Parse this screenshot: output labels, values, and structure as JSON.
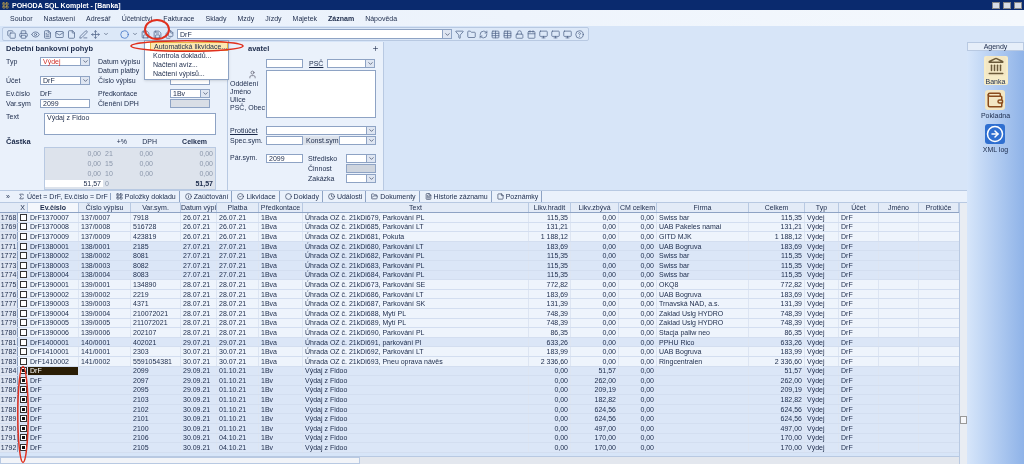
{
  "window": {
    "title": "POHODA SQL Komplet - [Banka]"
  },
  "menu": [
    {
      "label": "Soubor",
      "active": false
    },
    {
      "label": "Nastavení",
      "active": false
    },
    {
      "label": "Adresář",
      "active": false
    },
    {
      "label": "Účetnictví",
      "active": false
    },
    {
      "label": "Fakturace",
      "active": false
    },
    {
      "label": "Sklady",
      "active": false
    },
    {
      "label": "Mzdy",
      "active": false
    },
    {
      "label": "Jízdy",
      "active": false
    },
    {
      "label": "Majetek",
      "active": false
    },
    {
      "label": "Záznam",
      "active": true
    },
    {
      "label": "Nápověda",
      "active": false
    }
  ],
  "toolbar": {
    "combo_value": "DrF"
  },
  "dropdown": [
    {
      "label": "Automatická likvidace...",
      "selected": true
    },
    {
      "label": "Kontrola dokladů...",
      "selected": false
    },
    {
      "label": "Načtení avíz...",
      "selected": false
    },
    {
      "label": "Načtení výpisů...",
      "selected": false
    }
  ],
  "form": {
    "title": "Debetní bankovní pohyb",
    "typ_label": "Typ",
    "typ": "Výdej",
    "datum_vypisu_label": "Datum výpisu",
    "datum_platby_label": "Datum platby",
    "ucet_label": "Účet",
    "ucet": "DrF",
    "cislo_vypisu_label": "Číslo výpisu",
    "ev_cislo_label": "Ev.číslo",
    "ev_cislo": "DrF",
    "predkontace_label": "Předkontace",
    "predkontace": "1Bv",
    "var_sym_label": "Var.sym",
    "var_sym": "2099",
    "cleneni_label": "Členění DPH",
    "text_label": "Text",
    "text": "Výdaj z Fidoo",
    "castka_label": "Částka",
    "vat_headers": [
      "+%",
      "DPH",
      "Celkem"
    ],
    "vat_rows": [
      {
        "base": "0,00",
        "rate": "21",
        "vat": "0,00",
        "total": "0,00",
        "editable": false
      },
      {
        "base": "0,00",
        "rate": "15",
        "vat": "0,00",
        "total": "0,00",
        "editable": false
      },
      {
        "base": "0,00",
        "rate": "10",
        "vat": "0,00",
        "total": "0,00",
        "editable": false
      },
      {
        "base": "51,57",
        "rate": "0",
        "total": "51,57",
        "editable": true
      }
    ]
  },
  "partner": {
    "title": "avatel",
    "psc_label": "PSČ",
    "oddeleni_label": "Oddělení",
    "jmeno_label": "Jméno",
    "ulice_label": "Ulice",
    "psc_obec_label": "PSČ, Obec",
    "protiucet_label": "Protiúčet",
    "spec_sym_label": "Spec.sym.",
    "konst_sym_label": "Konst.sym.",
    "par_sym_label": "Pár.sym.",
    "par_sym": "2099",
    "stredisko_label": "Středisko",
    "cinnost_label": "Činnost",
    "zakazka_label": "Zakázka"
  },
  "agendy": {
    "title": "Agendy",
    "items": [
      {
        "label": "Banka",
        "selected": true,
        "kind": "bank"
      },
      {
        "label": "Pokladna",
        "selected": false,
        "kind": "wallet"
      },
      {
        "label": "XML log",
        "selected": false,
        "kind": "log"
      }
    ]
  },
  "tabs": {
    "more": "»",
    "filter": "Účet = DrF, Ev.číslo = DrF",
    "items": [
      {
        "label": "Položky dokladu",
        "selected": false
      },
      {
        "label": "Zaúčtování",
        "selected": false
      },
      {
        "label": "Likvidace",
        "selected": false
      },
      {
        "label": "Doklady",
        "selected": false
      },
      {
        "label": "Události",
        "selected": false
      },
      {
        "label": "Dokumenty",
        "selected": false
      },
      {
        "label": "Historie záznamu",
        "selected": false
      },
      {
        "label": "Poznámky",
        "selected": false
      }
    ]
  },
  "table": {
    "checkbox_header": "X",
    "columns": [
      {
        "label": "Ev.číslo",
        "sorted": true
      },
      {
        "label": "Číslo výpisu",
        "sorted": false
      },
      {
        "label": "Var.sym.",
        "sorted": false
      },
      {
        "label": "Datum výpi",
        "sorted": false
      },
      {
        "label": "Platba",
        "sorted": false
      },
      {
        "label": "Předkontace",
        "sorted": false
      },
      {
        "label": "Text",
        "sorted": false
      },
      {
        "label": "Likv.hradit",
        "sorted": false
      },
      {
        "label": "Likv.zbývá",
        "sorted": false
      },
      {
        "label": "CM celkem",
        "sorted": false
      },
      {
        "label": "Firma",
        "sorted": false
      },
      {
        "label": "Celkem",
        "sorted": false
      },
      {
        "label": "Typ",
        "sorted": false
      },
      {
        "label": "Účet",
        "sorted": false
      },
      {
        "label": "Jméno",
        "sorted": false
      },
      {
        "label": "Protiúče",
        "sorted": false
      }
    ],
    "rows": [
      {
        "number": "1768",
        "checked": false,
        "selected": false,
        "shaded": false,
        "cells": [
          "DrF1370007",
          "137/0007",
          "7918",
          "26.07.21",
          "26.07.21",
          "1Bva",
          "Úhrada OZ č. 21kDi679, Parkování PL",
          "115,35",
          "0,00",
          "0,00",
          "Swiss bar",
          "115,35",
          "Výdej",
          "DrF"
        ]
      },
      {
        "number": "1769",
        "checked": false,
        "selected": false,
        "shaded": false,
        "cells": [
          "DrF1370008",
          "137/0008",
          "516728",
          "26.07.21",
          "26.07.21",
          "1Bva",
          "Úhrada OZ č. 21kDi685, Parkování LT",
          "131,21",
          "0,00",
          "0,00",
          "UAB Pakeles namai",
          "131,21",
          "Výdej",
          "DrF"
        ]
      },
      {
        "number": "1770",
        "checked": false,
        "selected": false,
        "shaded": false,
        "cells": [
          "DrF1370009",
          "137/0009",
          "423819",
          "26.07.21",
          "26.07.21",
          "1Bva",
          "Úhrada OZ č. 21kDi681, Pokuta",
          "1 188,12",
          "0,00",
          "0,00",
          "GITD MJK",
          "1 188,12",
          "Výdej",
          "DrF"
        ]
      },
      {
        "number": "1771",
        "checked": false,
        "selected": false,
        "shaded": true,
        "cells": [
          "DrF1380001",
          "138/0001",
          "2185",
          "27.07.21",
          "27.07.21",
          "1Bva",
          "Úhrada OZ č. 21kDi680, Parkování LT",
          "183,69",
          "0,00",
          "0,00",
          "UAB Bogruva",
          "183,69",
          "Výdej",
          "DrF"
        ]
      },
      {
        "number": "1772",
        "checked": false,
        "selected": false,
        "shaded": true,
        "cells": [
          "DrF1380002",
          "138/0002",
          "8081",
          "27.07.21",
          "27.07.21",
          "1Bva",
          "Úhrada OZ č. 21kDi682, Parkování PL",
          "115,35",
          "0,00",
          "0,00",
          "Swiss bar",
          "115,35",
          "Výdej",
          "DrF"
        ]
      },
      {
        "number": "1773",
        "checked": false,
        "selected": false,
        "shaded": true,
        "cells": [
          "DrF1380003",
          "138/0003",
          "8082",
          "27.07.21",
          "27.07.21",
          "1Bva",
          "Úhrada OZ č. 21kDi683, Parkování PL",
          "115,35",
          "0,00",
          "0,00",
          "Swiss bar",
          "115,35",
          "Výdej",
          "DrF"
        ]
      },
      {
        "number": "1774",
        "checked": false,
        "selected": false,
        "shaded": true,
        "cells": [
          "DrF1380004",
          "138/0004",
          "8083",
          "27.07.21",
          "27.07.21",
          "1Bva",
          "Úhrada OZ č. 21kDi684, Parkování PL",
          "115,35",
          "0,00",
          "0,00",
          "Swiss bar",
          "115,35",
          "Výdej",
          "DrF"
        ]
      },
      {
        "number": "1775",
        "checked": false,
        "selected": false,
        "shaded": false,
        "cells": [
          "DrF1390001",
          "139/0001",
          "134890",
          "28.07.21",
          "28.07.21",
          "1Bva",
          "Úhrada OZ č. 21kDi673, Parkování SE",
          "772,82",
          "0,00",
          "0,00",
          "OKQ8",
          "772,82",
          "Výdej",
          "DrF"
        ]
      },
      {
        "number": "1776",
        "checked": false,
        "selected": false,
        "shaded": false,
        "cells": [
          "DrF1390002",
          "139/0002",
          "2219",
          "28.07.21",
          "28.07.21",
          "1Bva",
          "Úhrada OZ č. 21kDi686, Parkování LT",
          "183,69",
          "0,00",
          "0,00",
          "UAB Bogruva",
          "183,69",
          "Výdej",
          "DrF"
        ]
      },
      {
        "number": "1777",
        "checked": false,
        "selected": false,
        "shaded": false,
        "cells": [
          "DrF1390003",
          "139/0003",
          "4371",
          "28.07.21",
          "28.07.21",
          "1Bva",
          "Úhrada OZ č. 21kDi687, Parkování SK",
          "131,39",
          "0,00",
          "0,00",
          "Trnavská NAD, a.s.",
          "131,39",
          "Výdej",
          "DrF"
        ]
      },
      {
        "number": "1778",
        "checked": false,
        "selected": false,
        "shaded": false,
        "cells": [
          "DrF1390004",
          "139/0004",
          "210072021",
          "28.07.21",
          "28.07.21",
          "1Bva",
          "Úhrada OZ č. 21kDi688, Mytí PL",
          "748,39",
          "0,00",
          "0,00",
          "Zaklad Uslg HYDRO",
          "748,39",
          "Výdej",
          "DrF"
        ]
      },
      {
        "number": "1779",
        "checked": false,
        "selected": false,
        "shaded": false,
        "cells": [
          "DrF1390005",
          "139/0005",
          "211072021",
          "28.07.21",
          "28.07.21",
          "1Bva",
          "Úhrada OZ č. 21kDi689, Mytí PL",
          "748,39",
          "0,00",
          "0,00",
          "Zaklad Uslg HYDRO",
          "748,39",
          "Výdej",
          "DrF"
        ]
      },
      {
        "number": "1780",
        "checked": false,
        "selected": false,
        "shaded": false,
        "cells": [
          "DrF1390006",
          "139/0006",
          "202107",
          "28.07.21",
          "28.07.21",
          "1Bva",
          "Úhrada OZ č. 21kDi690, Parkování PL",
          "86,35",
          "0,00",
          "0,00",
          "Stacja paliw neo",
          "86,35",
          "Výdej",
          "DrF"
        ]
      },
      {
        "number": "1781",
        "checked": false,
        "selected": false,
        "shaded": true,
        "cells": [
          "DrF1400001",
          "140/0001",
          "402021",
          "29.07.21",
          "29.07.21",
          "1Bva",
          "Úhrada OZ č. 21kDi691, parkování Pl",
          "633,26",
          "0,00",
          "0,00",
          "PPHU Rico",
          "633,26",
          "Výdej",
          "DrF"
        ]
      },
      {
        "number": "1782",
        "checked": false,
        "selected": false,
        "shaded": false,
        "cells": [
          "DrF1410001",
          "141/0001",
          "2303",
          "30.07.21",
          "30.07.21",
          "1Bva",
          "Úhrada OZ č. 21kDi692, Parkování LT",
          "183,99",
          "0,00",
          "0,00",
          "UAB Bogruva",
          "183,99",
          "Výdej",
          "DrF"
        ]
      },
      {
        "number": "1783",
        "checked": false,
        "selected": false,
        "shaded": false,
        "cells": [
          "DrF1410002",
          "141/0002",
          "5591054381",
          "30.07.21",
          "30.07.21",
          "1Bva",
          "Úhrada OZ č. 21kDi693, Pneu oprava návěs",
          "2 336,60",
          "0,00",
          "0,00",
          "Ringcentralen",
          "2 336,60",
          "Výdej",
          "DrF"
        ]
      },
      {
        "number": "1784",
        "checked": true,
        "selected": true,
        "shaded": true,
        "cells": [
          "DrF",
          null,
          "2099",
          "29.09.21",
          "01.10.21",
          "1Bv",
          "Výdaj z Fidoo",
          "0,00",
          "51,57",
          "0,00",
          null,
          "51,57",
          "Výdej",
          "DrF"
        ]
      },
      {
        "number": "1785",
        "checked": true,
        "selected": false,
        "shaded": true,
        "cells": [
          "DrF",
          null,
          "2097",
          "29.09.21",
          "01.10.21",
          "1Bv",
          "Výdaj z Fidoo",
          "0,00",
          "262,00",
          "0,00",
          null,
          "262,00",
          "Výdej",
          "DrF"
        ]
      },
      {
        "number": "1786",
        "checked": true,
        "selected": false,
        "shaded": true,
        "cells": [
          "DrF",
          null,
          "2095",
          "29.09.21",
          "01.10.21",
          "1Bv",
          "Výdaj z Fidoo",
          "0,00",
          "209,19",
          "0,00",
          null,
          "209,19",
          "Výdej",
          "DrF"
        ]
      },
      {
        "number": "1787",
        "checked": true,
        "selected": false,
        "shaded": true,
        "cells": [
          "DrF",
          null,
          "2103",
          "30.09.21",
          "01.10.21",
          "1Bv",
          "Výdaj z Fidoo",
          "0,00",
          "182,82",
          "0,00",
          null,
          "182,82",
          "Výdej",
          "DrF"
        ]
      },
      {
        "number": "1788",
        "checked": true,
        "selected": false,
        "shaded": true,
        "cells": [
          "DrF",
          null,
          "2102",
          "30.09.21",
          "01.10.21",
          "1Bv",
          "Výdaj z Fidoo",
          "0,00",
          "624,56",
          "0,00",
          null,
          "624,56",
          "Výdej",
          "DrF"
        ]
      },
      {
        "number": "1789",
        "checked": true,
        "selected": false,
        "shaded": true,
        "cells": [
          "DrF",
          null,
          "2101",
          "30.09.21",
          "01.10.21",
          "1Bv",
          "Výdaj z Fidoo",
          "0,00",
          "624,56",
          "0,00",
          null,
          "624,56",
          "Výdej",
          "DrF"
        ]
      },
      {
        "number": "1790",
        "checked": true,
        "selected": false,
        "shaded": true,
        "cells": [
          "DrF",
          null,
          "2100",
          "30.09.21",
          "01.10.21",
          "1Bv",
          "Výdaj z Fidoo",
          "0,00",
          "497,00",
          "0,00",
          null,
          "497,00",
          "Výdej",
          "DrF"
        ]
      },
      {
        "number": "1791",
        "checked": true,
        "selected": false,
        "shaded": true,
        "cells": [
          "DrF",
          null,
          "2106",
          "30.09.21",
          "04.10.21",
          "1Bv",
          "Výdaj z Fidoo",
          "0,00",
          "170,00",
          "0,00",
          null,
          "170,00",
          "Výdej",
          "DrF"
        ]
      },
      {
        "number": "1792",
        "checked": true,
        "selected": false,
        "shaded": true,
        "cells": [
          "DrF",
          null,
          "2105",
          "30.09.21",
          "04.10.21",
          "1Bv",
          "Výdaj z Fidoo",
          "0,00",
          "170,00",
          "0,00",
          null,
          "170,00",
          "Výdej",
          "DrF"
        ]
      }
    ]
  }
}
